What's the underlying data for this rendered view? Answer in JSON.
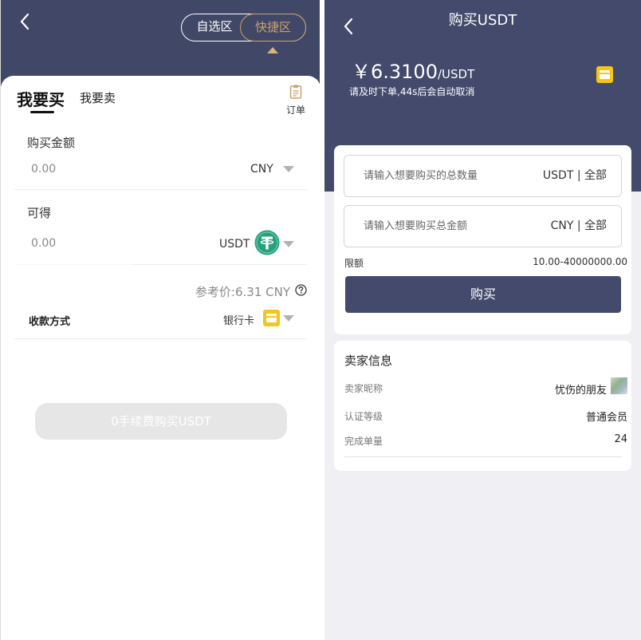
{
  "left": {
    "segment": {
      "option_1": "自选区",
      "option_2": "快捷区"
    },
    "tabs": {
      "buy": "我要买",
      "sell": "我要卖"
    },
    "order_label": "订单",
    "amount_field": {
      "label": "购买金额",
      "value": "0.00",
      "unit": "CNY"
    },
    "receive_field": {
      "label": "可得",
      "value": "0.00",
      "unit": "USDT"
    },
    "reference_price": "参考价:6.31 CNY",
    "payment": {
      "label": "收款方式",
      "value": "银行卡"
    },
    "submit_label": "0手续费购买USDT"
  },
  "right": {
    "title": "购买USDT",
    "price": "￥6.3100",
    "price_unit": "/USDT",
    "countdown": "请及时下单,44s后会自动取消",
    "quantity_input": {
      "placeholder": "请输入想要购买的总数量",
      "suffix": "USDT | 全部"
    },
    "amount_input": {
      "placeholder": "请输入想要购买总金额",
      "suffix": "CNY | 全部"
    },
    "limit": {
      "label": "限额",
      "value": "10.00-40000000.00"
    },
    "buy_label": "购买",
    "seller": {
      "title": "卖家信息",
      "rows": [
        {
          "label": "卖家昵称",
          "value": "忧伤的朋友"
        },
        {
          "label": "认证等级",
          "value": "普通会员"
        },
        {
          "label": "完成单量",
          "value": "24"
        }
      ]
    }
  },
  "colors": {
    "header_bg": "#414766",
    "accent_gold": "#c9a36b",
    "button_primary": "#434a6b",
    "button_disabled": "#e6e6e6",
    "tether_green": "#26a17b",
    "card_yellow": "#f5c518"
  }
}
